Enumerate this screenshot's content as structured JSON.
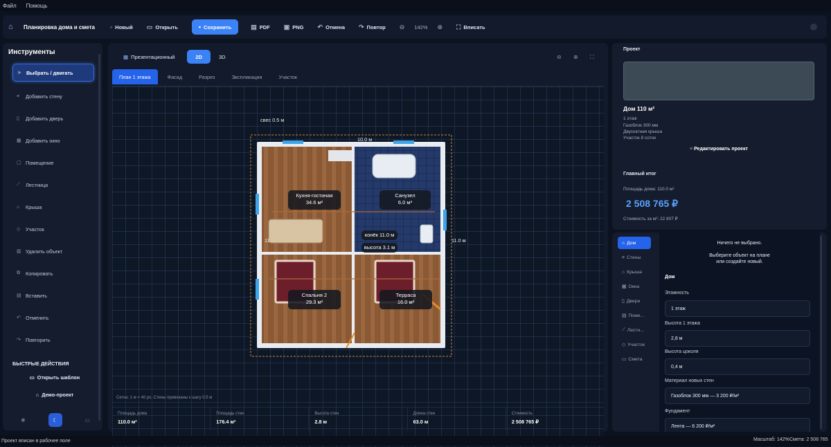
{
  "menu": [
    "Файл",
    "Помощь"
  ],
  "toolbar": {
    "title": "Планировка дома и смета",
    "new": "Новый",
    "open": "Открыть",
    "save": "Сохранить",
    "pdf": "PDF",
    "png": "PNG",
    "undo": "Отмена",
    "redo": "Повтор",
    "zoom": "142%",
    "fit": "Вписать"
  },
  "tools": {
    "heading": "Инструменты",
    "items": [
      "Выбрать / двигать",
      "Добавить стену",
      "Добавить дверь",
      "Добавить окно",
      "Помещение",
      "Лестница",
      "Крыша",
      "Участок",
      "Удалить объект",
      "Копировать",
      "Вставить",
      "Отменить",
      "Повторить"
    ],
    "quick_heading": "БЫСТРЫЕ ДЕЙСТВИЯ",
    "open_template": "Открыть шаблон",
    "demo_project": "Демо-проект"
  },
  "view": {
    "presentation": "Презентационный",
    "mode_2d": "2D",
    "mode_3d": "3D",
    "tabs": [
      "План 1 этажа",
      "Фасад",
      "Разрез",
      "Экспликация",
      "Участок"
    ],
    "grid_note": "Сетка: 1 м = 40 px. Стены привязаны к шагу 0.5 м"
  },
  "plan": {
    "overhang": "свес 0.5 м",
    "width_dim": "10.0 м",
    "height_dim": "11.0 м",
    "left_dim": "11",
    "ridge": "конёк 11.0 м",
    "height": "высота 3.1 м",
    "rooms": [
      {
        "name": "Кухня-гостиная",
        "area": "34.6 м²"
      },
      {
        "name": "Санузел",
        "area": "6.0 м²"
      },
      {
        "name": "Спальня 2",
        "area": "29.3 м²"
      },
      {
        "name": "Терраса",
        "area": "16.0 м²"
      }
    ]
  },
  "stats": [
    {
      "label": "Площадь дома",
      "value": "110.0 м²"
    },
    {
      "label": "Площадь стен",
      "value": "176.4 м²"
    },
    {
      "label": "Высота стен",
      "value": "2.8 м"
    },
    {
      "label": "Длина стен",
      "value": "63.0 м"
    },
    {
      "label": "Стоимость",
      "value": "2 508 765 ₽"
    }
  ],
  "project": {
    "heading": "Проект",
    "title": "Дом 110 м²",
    "lines": [
      "1 этаж",
      "Газоблок 300 мм",
      "Двускатная крыша",
      "Участок 8 соток"
    ],
    "edit": "Редактировать проект",
    "total_heading": "Главный итог",
    "area_line": "Площадь дома: 110.0 м²",
    "price": "2 508 765 ₽",
    "per_m2": "Стоимость за м²: 22 807 ₽"
  },
  "props": {
    "tabs": [
      "Дом",
      "Стены",
      "Крыша",
      "Окна",
      "Двери",
      "Поме...",
      "Лестн...",
      "Участок",
      "Смета"
    ],
    "empty_title": "Ничего не выбрано.",
    "empty_hint_1": "Выберите объект на плане",
    "empty_hint_2": "или создайте новый.",
    "section": "Дом",
    "fields": [
      {
        "label": "Этажность",
        "value": "1 этаж"
      },
      {
        "label": "Высота 1 этажа",
        "value": "2,8 м"
      },
      {
        "label": "Высота цоколя",
        "value": "0,4 м"
      },
      {
        "label": "Материал новых стен",
        "value": "Газоблок 300 мм — 3 200 ₽/м²"
      },
      {
        "label": "Фундамент",
        "value": "Лента — 6 200 ₽/м²"
      }
    ]
  },
  "status": {
    "left": "Проект вписан в рабочее поле",
    "scale": "Масштаб: 142%",
    "cost": "Смета: 2 508 765"
  }
}
